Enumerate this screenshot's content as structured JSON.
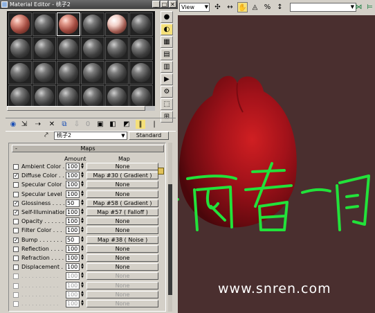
{
  "window": {
    "title": "Material Editor - 桃子2",
    "controls": {
      "minimize": "_",
      "restore": "□",
      "close": "✕"
    }
  },
  "slots": {
    "rows": 4,
    "cols": 6,
    "colored": {
      "0": "red",
      "2": "red",
      "4": "white"
    },
    "selected": 2
  },
  "sidebar": {
    "icons": [
      "sample-type-icon",
      "backlight-icon",
      "background-icon",
      "uv-tiling-icon",
      "video-color-check-icon",
      "make-preview-icon",
      "options-icon",
      "select-by-material-icon",
      "material-map-navigator-icon"
    ]
  },
  "toolbar": {
    "icons": [
      "get-material-icon",
      "put-to-scene-icon",
      "assign-to-selection-icon",
      "reset-map-icon",
      "make-unique-icon",
      "put-to-library-icon",
      "material-effects-channel-icon",
      "show-map-in-viewport-icon",
      "show-end-result-icon",
      "go-to-parent-icon",
      "go-forward-sibling-icon"
    ]
  },
  "material": {
    "name": "桃子2",
    "type_button": "Standard"
  },
  "maps": {
    "rollout_title": "Maps",
    "rollout_toggle": "-",
    "col_amount": "Amount",
    "col_map": "Map",
    "rows": [
      {
        "label": "Ambient Color . .",
        "checked": false,
        "amount": "100",
        "map": "None",
        "enabled": true
      },
      {
        "label": "Diffuse Color . . .",
        "checked": true,
        "amount": "100",
        "map": "Map #30 ( Gradient )",
        "enabled": true
      },
      {
        "label": "Specular Color . .",
        "checked": false,
        "amount": "100",
        "map": "None",
        "enabled": true
      },
      {
        "label": "Specular Level . .",
        "checked": false,
        "amount": "100",
        "map": "None",
        "enabled": true
      },
      {
        "label": "Glossiness . . . .",
        "checked": true,
        "amount": "50",
        "map": "Map #58 ( Gradient )",
        "enabled": true
      },
      {
        "label": "Self-Illumination .",
        "checked": true,
        "amount": "100",
        "map": "Map #57 ( Falloff )",
        "enabled": true
      },
      {
        "label": "Opacity . . . . . .",
        "checked": false,
        "amount": "100",
        "map": "None",
        "enabled": true
      },
      {
        "label": "Filter Color . . . .",
        "checked": false,
        "amount": "100",
        "map": "None",
        "enabled": true
      },
      {
        "label": "Bump . . . . . . . .",
        "checked": true,
        "amount": "50",
        "map": "Map #38 ( Noise )",
        "enabled": true
      },
      {
        "label": "Reflection . . . . .",
        "checked": false,
        "amount": "100",
        "map": "None",
        "enabled": true
      },
      {
        "label": "Refraction . . . . .",
        "checked": false,
        "amount": "100",
        "map": "None",
        "enabled": true
      },
      {
        "label": "Displacement . . .",
        "checked": false,
        "amount": "100",
        "map": "None",
        "enabled": true
      },
      {
        "label": ". . . . . . . . . . .",
        "checked": false,
        "amount": "100",
        "map": "None",
        "enabled": false
      },
      {
        "label": ". . . . . . . . . . .",
        "checked": false,
        "amount": "100",
        "map": "None",
        "enabled": false
      },
      {
        "label": ". . . . . . . . . . .",
        "checked": false,
        "amount": "100",
        "map": "None",
        "enabled": false
      },
      {
        "label": ". . . . . . . . . . .",
        "checked": false,
        "amount": "100",
        "map": "None",
        "enabled": false
      }
    ]
  },
  "viewport_toolbar": {
    "view_label": "View",
    "dropdown_arrow": "▼"
  },
  "viewport": {
    "background_color": "#4a2f2f",
    "object_color": "#9e1216",
    "annotation_text": ">西看一周",
    "annotation_color": "#22e23a",
    "watermark": "www.snren.com"
  }
}
